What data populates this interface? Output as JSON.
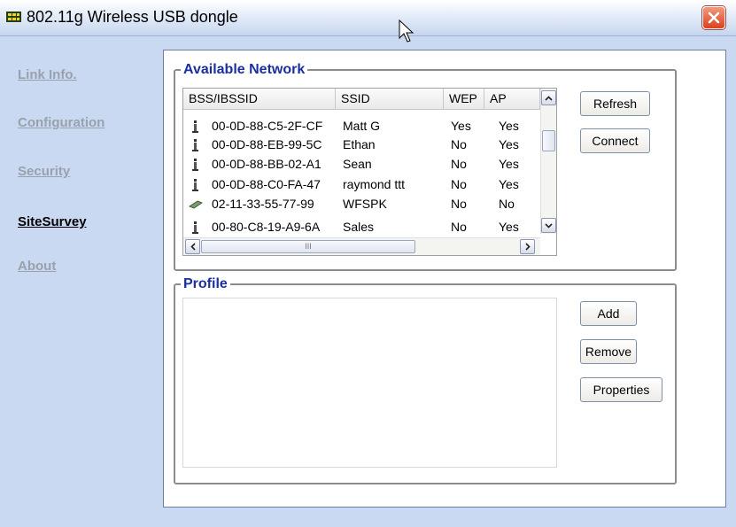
{
  "window": {
    "title": "802.11g Wireless USB dongle"
  },
  "sidebar": {
    "items": [
      {
        "label": "Link Info.",
        "active": false
      },
      {
        "label": "Configuration",
        "active": false
      },
      {
        "label": "Security",
        "active": false
      },
      {
        "label": "SiteSurvey",
        "active": true
      },
      {
        "label": "About",
        "active": false
      }
    ]
  },
  "available_network": {
    "legend": "Available Network",
    "columns": [
      "BSS/IBSSID",
      "SSID",
      "WEP",
      "AP"
    ],
    "rows": [
      {
        "icon": "infrastructure-ap-icon",
        "bssid": "00-0D-88-C5-2F-CF",
        "ssid": "Matt G",
        "wep": "Yes",
        "ap": "Yes"
      },
      {
        "icon": "infrastructure-ap-icon",
        "bssid": "00-0D-88-EB-99-5C",
        "ssid": "Ethan",
        "wep": "No",
        "ap": "Yes"
      },
      {
        "icon": "infrastructure-ap-icon",
        "bssid": "00-0D-88-BB-02-A1",
        "ssid": "Sean",
        "wep": "No",
        "ap": "Yes"
      },
      {
        "icon": "infrastructure-ap-icon",
        "bssid": "00-0D-88-C0-FA-47",
        "ssid": "raymond ttt",
        "wep": "No",
        "ap": "Yes"
      },
      {
        "icon": "adhoc-network-icon",
        "bssid": "02-11-33-55-77-99",
        "ssid": "WFSPK",
        "wep": "No",
        "ap": "No"
      },
      {
        "icon": "infrastructure-ap-icon",
        "bssid": "00-80-C8-19-A9-6A",
        "ssid": "Sales",
        "wep": "No",
        "ap": "Yes"
      }
    ],
    "refresh_label": "Refresh",
    "connect_label": "Connect",
    "hscroll_grip": "III"
  },
  "profile": {
    "legend": "Profile",
    "add_label": "Add",
    "remove_label": "Remove",
    "properties_label": "Properties"
  }
}
